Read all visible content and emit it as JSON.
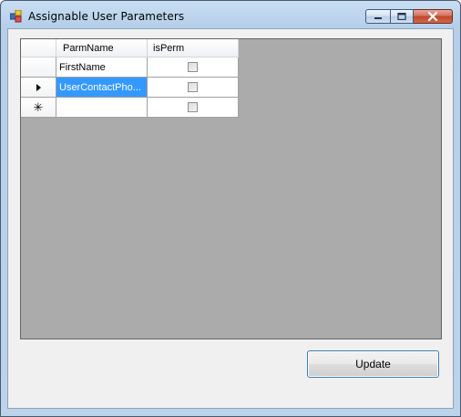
{
  "window": {
    "title": "Assignable User Parameters"
  },
  "grid": {
    "columns": [
      "ParmName",
      "isPerm"
    ],
    "rows": [
      {
        "parm_name": "FirstName",
        "is_perm": false,
        "selected": false,
        "indicator": ""
      },
      {
        "parm_name": "UserContactPho...",
        "is_perm": false,
        "selected": true,
        "indicator": "current-row-arrow"
      },
      {
        "parm_name": "",
        "is_perm": false,
        "selected": false,
        "indicator": "new-row-asterisk"
      }
    ],
    "new_row_glyph": "✳"
  },
  "buttons": {
    "update_label": "Update"
  },
  "colors": {
    "selection": "#3399ff",
    "grid_background": "#ababab",
    "client_background": "#f0f0f0"
  }
}
